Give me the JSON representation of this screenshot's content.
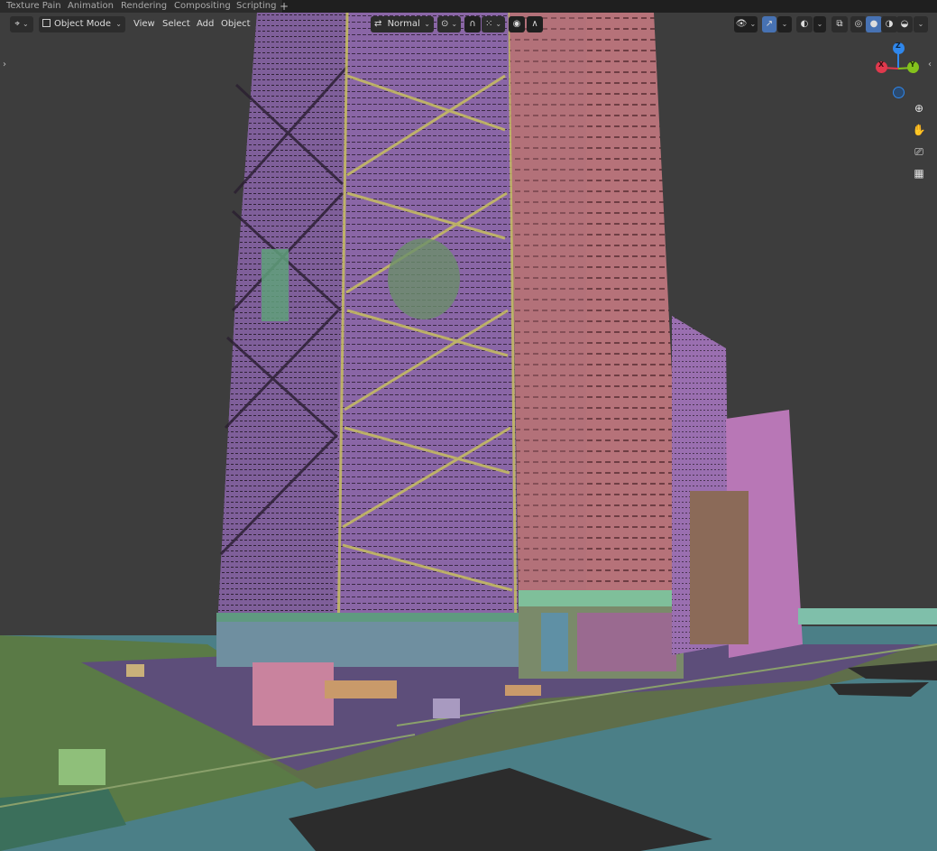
{
  "workspace_tabs": [
    "Texture Paint",
    "Animation",
    "Rendering",
    "Compositing",
    "Scripting"
  ],
  "workspace_add_label": "+",
  "header": {
    "mode_label": "Object Mode",
    "menus": [
      "View",
      "Select",
      "Add",
      "Object"
    ],
    "orientation_label": "Normal"
  },
  "gizmo": {
    "x_label": "X",
    "y_label": "Y",
    "z_label": "Z",
    "colors": {
      "x": "#e0394d",
      "y": "#84c21c",
      "z": "#2f87ec"
    }
  },
  "icons": {
    "editor_type": "viewport-icon",
    "mode": "object-mode-icon",
    "orientation": "transform-orientation-icon",
    "pivot": "pivot-point-icon",
    "snap": "snap-magnet-icon",
    "snap_grid": "snap-grid-icon",
    "proportional": "proportional-edit-icon",
    "visibility": "eye-icon",
    "gizmo_toggle": "gizmo-icon",
    "overlay": "overlay-icon",
    "xray": "xray-icon",
    "zoom": "zoom-icon",
    "pan": "hand-icon",
    "camera": "camera-icon",
    "ortho": "grid-icon"
  },
  "colors": {
    "background": "#3d3d3d",
    "header": "#2c2c2c",
    "accent": "#4772b3",
    "tower_purple": "#8d6aa8",
    "tower_pink": "#b7737a",
    "ground_teal": "#4f8a8f",
    "grass_green": "#5f7d4b"
  }
}
